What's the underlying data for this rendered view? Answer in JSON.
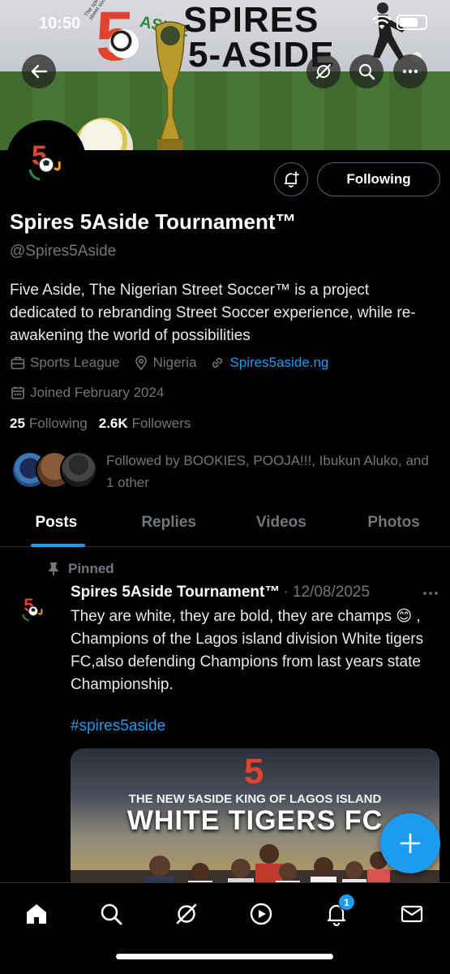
{
  "status_bar": {
    "time": "10:50"
  },
  "banner": {
    "headline_line1": "SPIRES",
    "headline_line2": "5-ASIDE",
    "logo_digit": "5",
    "logo_word": "ASIDE",
    "motto": "The spirit of Naija street soccer"
  },
  "header_actions": {
    "back_icon": "back-arrow-icon",
    "grok_icon": "grok-icon",
    "search_icon": "search-icon",
    "more_icon": "more-icon"
  },
  "profile": {
    "display_name": "Spires 5Aside Tournament™",
    "handle": "@Spires5Aside",
    "following_button": "Following",
    "bio": "Five Aside, The Nigerian Street Soccer™ is a project dedicated to rebranding Street Soccer experience, while re-awakening the world of possibilities",
    "category": "Sports League",
    "location": "Nigeria",
    "website": "Spires5aside.ng",
    "joined": "Joined February 2024",
    "following_count": "25",
    "following_label": "Following",
    "followers_count": "2.6K",
    "followers_label": "Followers",
    "followed_by": "Followed by BOOKIES, POOJA!!!, Ibukun Aluko, and 1 other"
  },
  "tabs": [
    "Posts",
    "Replies",
    "Videos",
    "Photos"
  ],
  "active_tab": "Posts",
  "post": {
    "pinned_label": "Pinned",
    "author": "Spires 5Aside Tournament™",
    "date": "· 12/08/2025",
    "text": "They are white, they are bold, they are champs 😊 , Champions of the Lagos island division White tigers FC,also defending Champions from last years state Championship.",
    "hashtag": "#spires5aside",
    "image": {
      "headline": "THE NEW 5ASIDE KING OF LAGOS ISLAND",
      "title": "WHITE TIGERS FC",
      "digit": "5"
    }
  },
  "bottom_nav": {
    "items": [
      "home-icon",
      "search-icon",
      "grok-icon",
      "video-icon",
      "notifications-icon",
      "messages-icon"
    ],
    "notification_count": "1"
  },
  "colors": {
    "accent": "#1d9bf0",
    "background": "#000000",
    "muted": "#71767b",
    "divider": "#2f3336"
  }
}
